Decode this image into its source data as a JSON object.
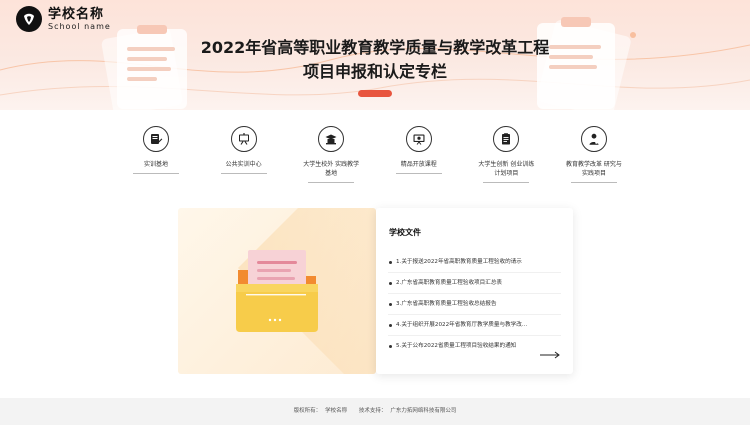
{
  "header": {
    "school_name": "学校名称",
    "school_name_en": "School name",
    "title_line1": "2022年省高等职业教育教学质量与教学改革工程",
    "title_line2": "项目申报和认定专栏",
    "accent_color": "#e8553e"
  },
  "nav": {
    "items": [
      {
        "label": "实训基地",
        "icon": "pen-paper-icon"
      },
      {
        "label": "公共实训中心",
        "icon": "easel-board-icon"
      },
      {
        "label": "大学生校外 实践教学基地",
        "icon": "graduation-cap-icon"
      },
      {
        "label": "精品开放课程",
        "icon": "presentation-screen-icon"
      },
      {
        "label": "大学生创新 创业训练计划项目",
        "icon": "clipboard-document-icon"
      },
      {
        "label": "教育教学改革 研究与实践项目",
        "icon": "person-medal-icon"
      }
    ]
  },
  "files": {
    "heading": "学校文件",
    "heading_highlight_color": "#f6d36b",
    "items": [
      "1.关于报送2022年省高职教育质量工程验收的请示",
      "2.广东省高职教育质量工程验收项目汇总表",
      "3.广东省高职教育质量工程验收总结报告",
      "4.关于组织开展2022年省教育厅教学质量与教学改...",
      "5.关于公布2022省质量工程项目验收结果的通知"
    ],
    "more_icon": "arrow-right-icon"
  },
  "footer": {
    "copyright_label": "版权所有：",
    "copyright_value": "学校名称",
    "support_label": "技术支持：",
    "support_value": "广东力拓网络科技有限公司"
  }
}
